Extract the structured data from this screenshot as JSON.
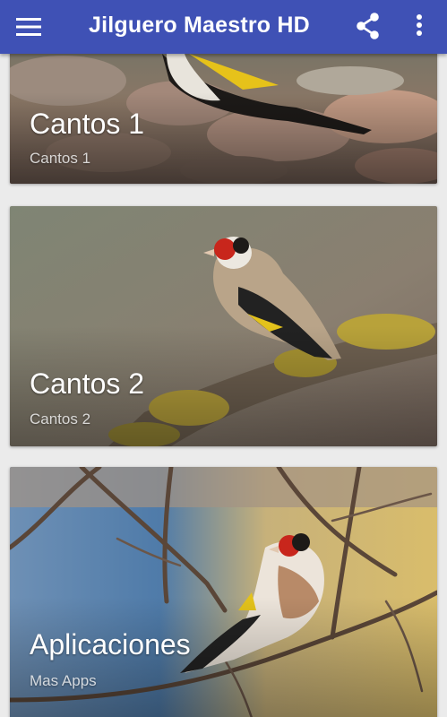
{
  "appbar": {
    "title": "Jilguero Maestro HD",
    "menu_icon": "menu-icon",
    "share_icon": "share-icon",
    "more_icon": "more-vert-icon",
    "color": "#3f51b5"
  },
  "cards": [
    {
      "title": "Cantos 1",
      "subtitle": "Cantos 1"
    },
    {
      "title": "Cantos 2",
      "subtitle": "Cantos 2"
    },
    {
      "title": "Aplicaciones",
      "subtitle": "Mas Apps"
    }
  ]
}
